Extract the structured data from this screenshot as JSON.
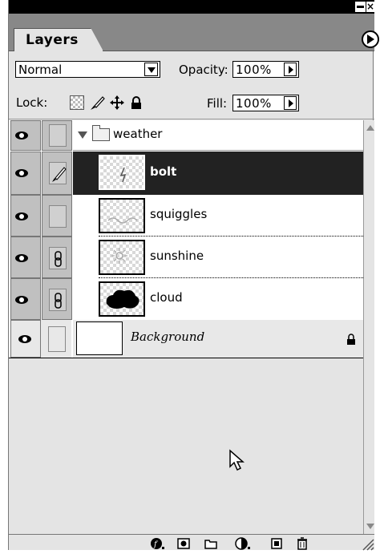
{
  "window": {
    "close_glyph": "×"
  },
  "tabs": [
    {
      "label": "Layers"
    }
  ],
  "blend": {
    "mode": "Normal",
    "opacity_label": "Opacity:",
    "opacity_value": "100%"
  },
  "lock": {
    "label": "Lock:",
    "fill_label": "Fill:",
    "fill_value": "100%"
  },
  "layers": {
    "group": {
      "name": "weather"
    },
    "items": [
      {
        "name": "bolt",
        "selected": true
      },
      {
        "name": "squiggles"
      },
      {
        "name": "sunshine",
        "linked": true
      },
      {
        "name": "cloud",
        "linked": true
      }
    ],
    "background": {
      "name": "Background",
      "locked": true
    }
  },
  "colors": {
    "selection": "#222222",
    "panel": "#e4e4e4",
    "visibility_cell": "#c0c0c0"
  }
}
